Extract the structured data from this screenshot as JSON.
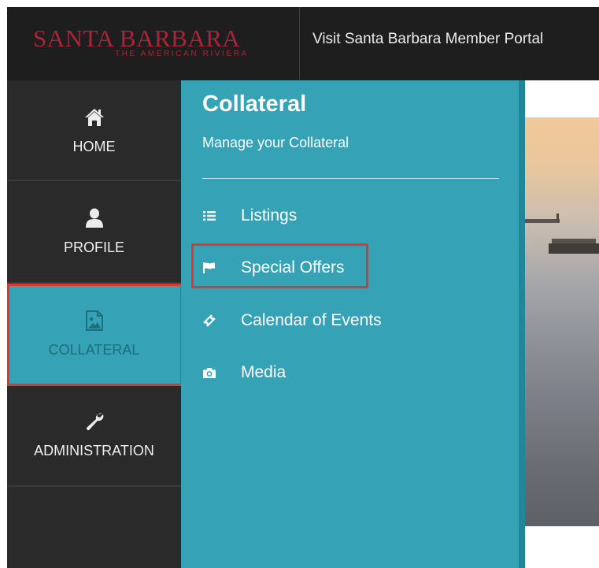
{
  "header": {
    "logo_main": "SANTA BARBARA",
    "logo_sub": "THE AMERICAN RIVIERA",
    "portal_title": "Visit Santa Barbara Member Portal"
  },
  "sidebar": {
    "items": [
      {
        "label": "HOME",
        "icon": "home-icon"
      },
      {
        "label": "PROFILE",
        "icon": "user-icon"
      },
      {
        "label": "COLLATERAL",
        "icon": "image-file-icon",
        "active": true
      },
      {
        "label": "ADMINISTRATION",
        "icon": "wrench-icon"
      }
    ]
  },
  "subpanel": {
    "title": "Collateral",
    "description": "Manage your Collateral",
    "items": [
      {
        "label": "Listings",
        "icon": "list-icon"
      },
      {
        "label": "Special Offers",
        "icon": "flag-icon"
      },
      {
        "label": "Calendar of Events",
        "icon": "ticket-icon"
      },
      {
        "label": "Media",
        "icon": "camera-icon"
      }
    ]
  },
  "colors": {
    "topbar": "#1e1e1e",
    "sidebar": "#2a2a2a",
    "accent_teal": "#35a2b5",
    "teal_dark": "#1f8798",
    "brand_red": "#a82438",
    "highlight_red": "#e0372c"
  }
}
